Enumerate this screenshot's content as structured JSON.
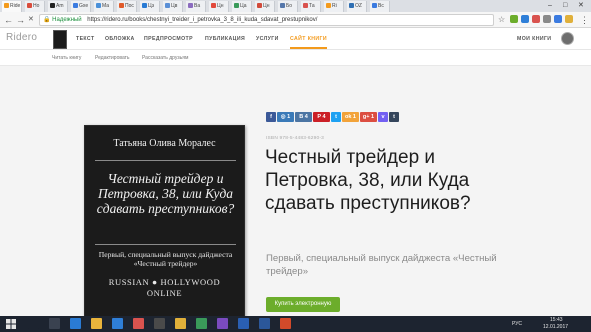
{
  "browser": {
    "tabs": [
      {
        "label": "Ride",
        "color": "#f39a1c"
      },
      {
        "label": "Но",
        "color": "#d94c3c"
      },
      {
        "label": "Am",
        "color": "#222222"
      },
      {
        "label": "Gxe",
        "color": "#3b7be0"
      },
      {
        "label": "Ма",
        "color": "#4a90d9"
      },
      {
        "label": "Пос",
        "color": "#e05a2a"
      },
      {
        "label": "Цз",
        "color": "#2a7bd4"
      },
      {
        "label": "Цв",
        "color": "#5a8fd6"
      },
      {
        "label": "Ва",
        "color": "#8b6cbf"
      },
      {
        "label": "Цн",
        "color": "#e24a3c"
      },
      {
        "label": "Ца",
        "color": "#3a9a5a"
      },
      {
        "label": "Цн",
        "color": "#d14a3a"
      },
      {
        "label": "Бо",
        "color": "#5577aa"
      },
      {
        "label": "Та",
        "color": "#d9534f"
      },
      {
        "label": "Ri",
        "color": "#f39a1c"
      },
      {
        "label": "OZ",
        "color": "#2f6fb3"
      },
      {
        "label": "Вс",
        "color": "#3b7be0"
      }
    ],
    "window_controls": {
      "minimize": "–",
      "maximize": "□",
      "close": "✕"
    },
    "back": "←",
    "forward": "→",
    "reload": "✕",
    "lock_icon": "🔒",
    "secure_label": "Надежный",
    "url": "https://ridero.ru/books/chestnyi_treider_i_petrovka_3_8_ili_kuda_sdavat_prestupnikov/",
    "star": "☆",
    "menu": "⋮"
  },
  "site": {
    "logo": "Ridero",
    "nav": {
      "text": "ТЕКСТ",
      "cover": "ОБЛОЖКА",
      "preview": "ПРЕДПРОСМОТР",
      "publication": "ПУБЛИКАЦИЯ",
      "services": "УСЛУГИ",
      "book_site": "САЙТ КНИГИ",
      "my_books": "МОИ КНИГИ"
    },
    "subnav": {
      "read": "Читать книгу",
      "edit": "Редактировать",
      "tell": "Рассказать друзьям"
    }
  },
  "cover": {
    "author": "Татьяна Олива Моралес",
    "title": "Честный трейдер и Петровка, 38, или Куда сдавать преступников?",
    "subtitle": "Первый, специальный выпуск дайджеста «Честный трейдер»",
    "series_line1": "RUSSIAN ● HOLLYWOOD",
    "series_line2": "ONLINE"
  },
  "share": [
    {
      "label": "f",
      "count": "",
      "color": "#3b5998"
    },
    {
      "label": "◎",
      "count": "1",
      "color": "#3a7ab8"
    },
    {
      "label": "В",
      "count": "4",
      "color": "#4c75a3"
    },
    {
      "label": "P",
      "count": "4",
      "color": "#cb2027"
    },
    {
      "label": "t",
      "count": "",
      "color": "#1da1f2"
    },
    {
      "label": "ok",
      "count": "1",
      "color": "#f2a33a"
    },
    {
      "label": "g+",
      "count": "1",
      "color": "#dc4e41"
    },
    {
      "label": "v",
      "count": "",
      "color": "#7360f2"
    },
    {
      "label": "t",
      "count": "",
      "color": "#35465c"
    }
  ],
  "book": {
    "isbn": "ISBN 978-5-4483-6290-3",
    "title": "Честный трейдер и Петровка, 38, или Куда сдавать преступников?",
    "subtitle": "Первый, специальный выпуск дайджеста «Честный трейдер»",
    "buy_label": "Купить электронную"
  },
  "taskbar": {
    "start_icon": "windows-logo",
    "language": "РУС",
    "time": "15:43",
    "date": "12.01.2017",
    "apps": [
      {
        "name": "search",
        "color": "#1d2430"
      },
      {
        "name": "task-view",
        "color": "#3a4250"
      },
      {
        "name": "edge",
        "color": "#2a7bd4"
      },
      {
        "name": "explorer",
        "color": "#e9b43c"
      },
      {
        "name": "store",
        "color": "#2f7fd8"
      },
      {
        "name": "mail",
        "color": "#d9534f"
      },
      {
        "name": "app6",
        "color": "#4a4a4a"
      },
      {
        "name": "chrome",
        "color": "#e0b03a"
      },
      {
        "name": "app8",
        "color": "#3a9a5a"
      },
      {
        "name": "app9",
        "color": "#7b4bbf"
      },
      {
        "name": "app10",
        "color": "#2a5fb3"
      },
      {
        "name": "word",
        "color": "#2b579a"
      },
      {
        "name": "app12",
        "color": "#d24a2a"
      }
    ]
  }
}
